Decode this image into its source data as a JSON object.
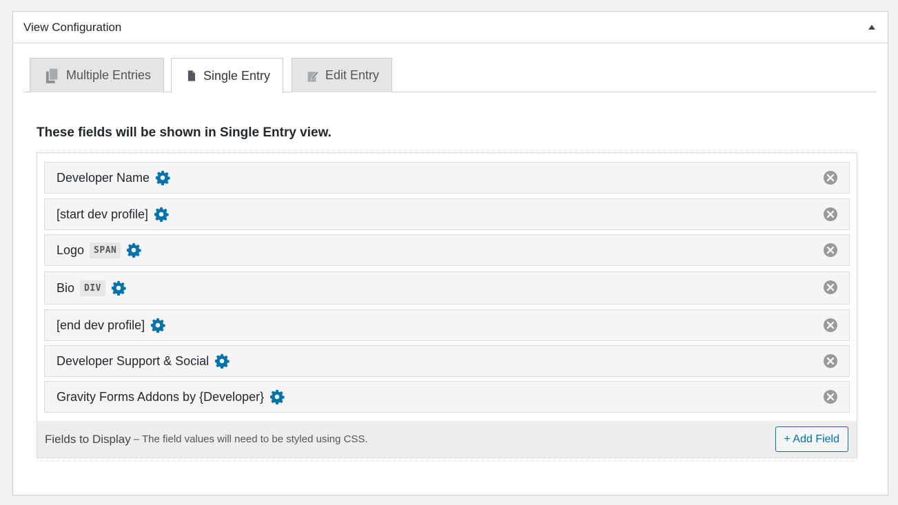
{
  "postbox": {
    "title": "View Configuration"
  },
  "tabs": [
    {
      "label": "Multiple Entries",
      "icon": "copy-pages-icon",
      "active": false
    },
    {
      "label": "Single Entry",
      "icon": "document-icon",
      "active": true
    },
    {
      "label": "Edit Entry",
      "icon": "edit-page-icon",
      "active": false
    }
  ],
  "section": {
    "heading": "These fields will be shown in Single Entry view."
  },
  "fields": [
    {
      "label": "Developer Name",
      "tag": ""
    },
    {
      "label": "[start dev profile]",
      "tag": ""
    },
    {
      "label": "Logo",
      "tag": "SPAN"
    },
    {
      "label": "Bio",
      "tag": "DIV"
    },
    {
      "label": "[end dev profile]",
      "tag": ""
    },
    {
      "label": "Developer Support & Social",
      "tag": ""
    },
    {
      "label": "Gravity Forms Addons by {Developer}",
      "tag": ""
    }
  ],
  "footer": {
    "title": "Fields to Display",
    "description": "– The field values will need to be styled using CSS.",
    "add_button": "+ Add Field"
  },
  "colors": {
    "gear": "#0073aa",
    "remove": "#999999",
    "button_accent": "#0071a1"
  }
}
